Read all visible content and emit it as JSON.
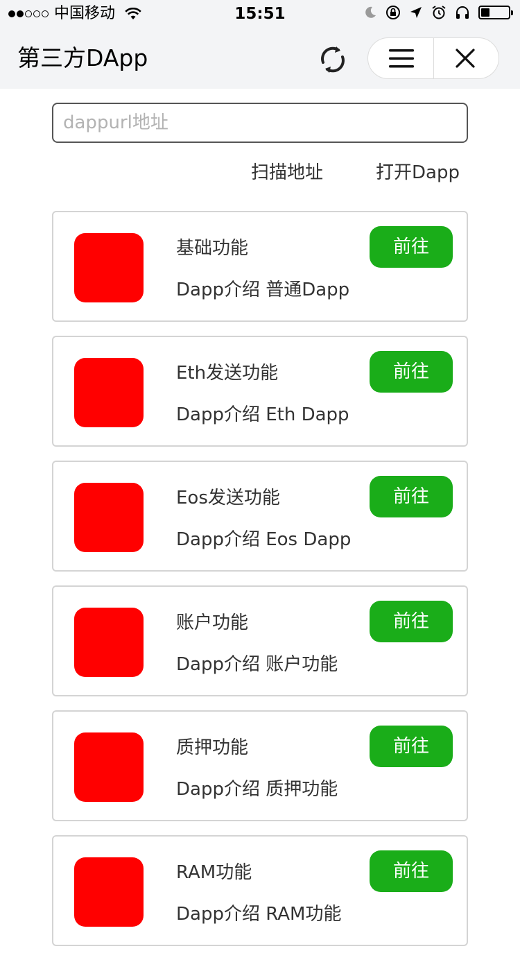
{
  "status_bar": {
    "carrier": "中国移动",
    "time": "15:51",
    "signal_dots_full": 2,
    "signal_dots_total": 5,
    "battery_level": 0.25
  },
  "nav": {
    "title": "第三方DApp",
    "icons": [
      "refresh-icon",
      "menu-icon",
      "close-icon"
    ]
  },
  "search": {
    "placeholder": "dappurl地址",
    "value": ""
  },
  "actions": {
    "scan_label": "扫描地址",
    "open_label": "打开Dapp"
  },
  "dapps": [
    {
      "name": "基础功能",
      "desc": "Dapp介绍 普通Dapp",
      "button": "前往"
    },
    {
      "name": "Eth发送功能",
      "desc": "Dapp介绍 Eth Dapp",
      "button": "前往"
    },
    {
      "name": "Eos发送功能",
      "desc": "Dapp介绍 Eos Dapp",
      "button": "前往"
    },
    {
      "name": "账户功能",
      "desc": "Dapp介绍 账户功能",
      "button": "前往"
    },
    {
      "name": "质押功能",
      "desc": "Dapp介绍 质押功能",
      "button": "前往"
    },
    {
      "name": "RAM功能",
      "desc": "Dapp介绍 RAM功能",
      "button": "前往"
    }
  ],
  "colors": {
    "accent": "#1aad19",
    "icon_placeholder": "#ff0000",
    "nav_background": "#f3f4f6"
  }
}
